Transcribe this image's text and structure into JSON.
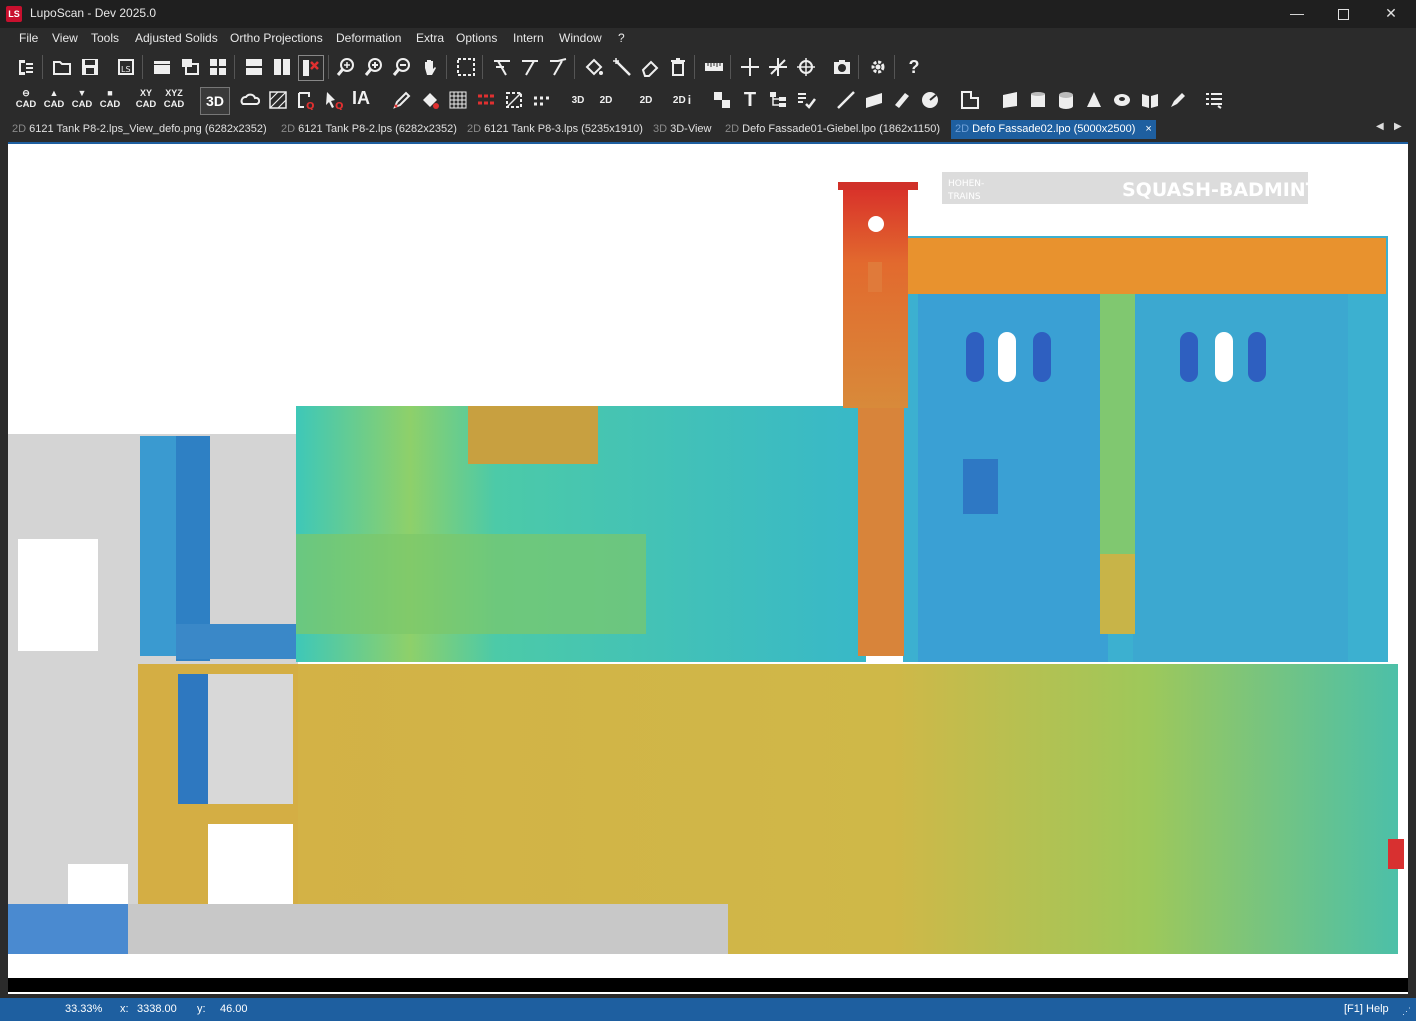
{
  "window": {
    "title": "LupoScan - Dev 2025.0",
    "logo_text": "LS"
  },
  "menu": [
    "File",
    "View",
    "Tools",
    "Adjusted Solids",
    "Ortho Projections",
    "Deformation",
    "Extra",
    "Options",
    "Intern",
    "Window",
    "?"
  ],
  "toolbar2": {
    "cad_labels": [
      "CAD",
      "CAD",
      "CAD",
      "CAD"
    ],
    "xy_cad": {
      "top": "XY",
      "bottom": "CAD"
    },
    "xyz_cad": {
      "top": "XYZ",
      "bottom": "CAD"
    },
    "three_d": "3D",
    "ia": "IA",
    "label_3d_a": "3D",
    "label_2d_a": "2D",
    "label_2d_b": "2D",
    "label_2d_i": "2D",
    "label_i": "i"
  },
  "tabs": [
    {
      "type": "2D",
      "label": "6121 Tank P8-2.lps_View_defo.png (6282x2352)",
      "active": false
    },
    {
      "type": "2D",
      "label": "6121 Tank P8-2.lps (6282x2352)",
      "active": false
    },
    {
      "type": "2D",
      "label": "6121 Tank P8-3.lps (5235x1910)",
      "active": false
    },
    {
      "type": "3D",
      "label": "3D-View",
      "active": false
    },
    {
      "type": "2D",
      "label": "Defo Fassade01-Giebel.lpo (1862x1150)",
      "active": false
    },
    {
      "type": "2D",
      "label": "Defo Fassade02.lpo (5000x2500)",
      "active": true
    }
  ],
  "tab_close": "×",
  "viewport": {
    "sign_text": "SQUASH-BADMINTON",
    "sign_small_1": "HOHEN-",
    "sign_small_2": "TRAINS"
  },
  "status": {
    "zoom": "33.33%",
    "x_label": "x:",
    "x_value": "3338.00",
    "y_label": "y:",
    "y_value": "46.00",
    "help": "[F1] Help"
  }
}
